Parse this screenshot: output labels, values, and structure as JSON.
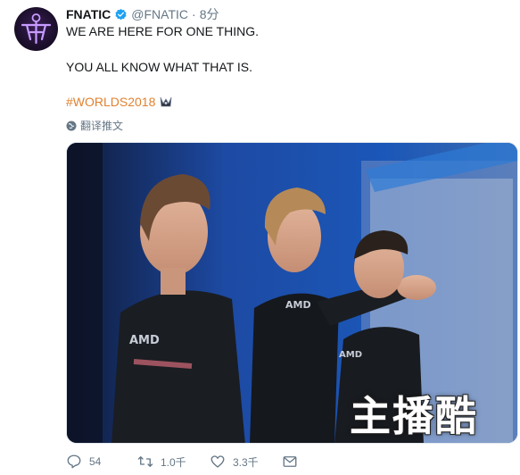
{
  "tweet": {
    "display_name": "FNATIC",
    "handle": "@FNATIC",
    "separator": "·",
    "time": "8分",
    "line1": "WE ARE HERE FOR ONE THING.",
    "line2": "YOU ALL KNOW WHAT THAT IS.",
    "hashtag": "#WORLDS2018",
    "translate_label": "翻译推文",
    "watermark": "主播酷"
  },
  "icons": {
    "avatar": "fnatic-logo",
    "verified": "verified-badge-icon",
    "hashtag_emoji": "worlds-trophy-icon",
    "translate": "globe-icon",
    "reply": "reply-icon",
    "retweet": "retweet-icon",
    "like": "heart-icon",
    "message": "envelope-icon"
  },
  "actions": {
    "replies": "54",
    "retweets": "1.0千",
    "likes": "3.3千"
  },
  "colors": {
    "hashtag": "#e0812f",
    "verified": "#1da1f2",
    "muted": "#657786",
    "text": "#14171a",
    "brand_accent": "#b17cff"
  }
}
